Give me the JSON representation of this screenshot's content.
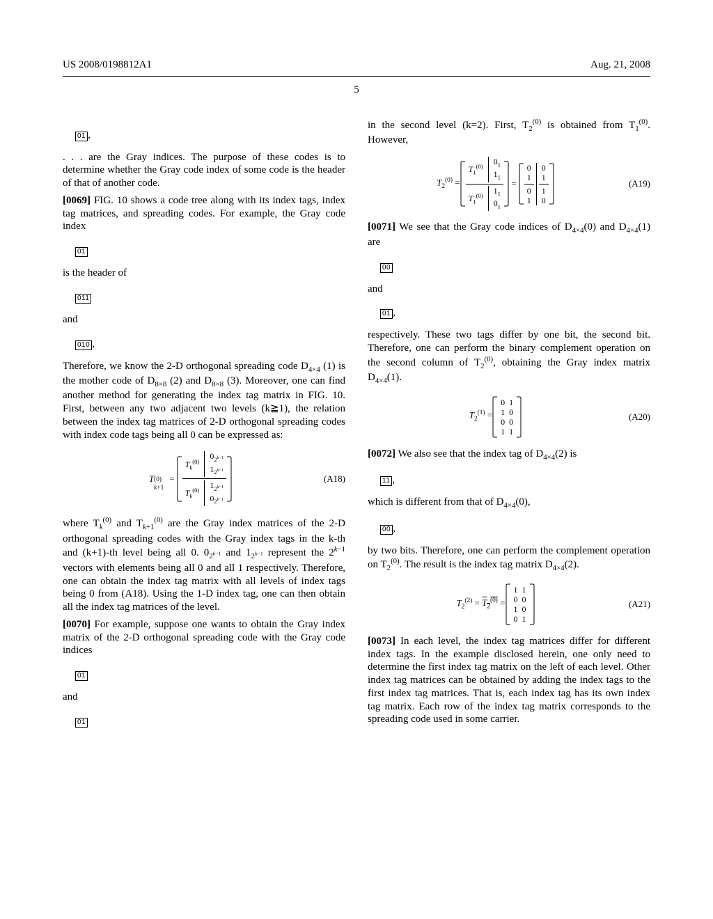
{
  "header": {
    "pub_no": "US 2008/0198812A1",
    "date": "Aug. 21, 2008",
    "page_no": "5"
  },
  "left": {
    "box1": "01",
    "p1": ". . . are the Gray indices. The purpose of these codes is to determine whether the Gray code index of some code is the header of that of another code.",
    "p2_ref": "[0069]",
    "p2": " FIG. 10 shows a code tree along with its index tags, index tag matrices, and spreading codes. For example, the Gray code index",
    "box2": "01",
    "p3": "is the header of",
    "box3": "011",
    "p4": "and",
    "box4": "010",
    "p5a": "Therefore, we know the 2-D orthogonal spreading code D",
    "p5b": " (1) is the mother code of D",
    "p5c": " (2) and D",
    "p5d": " (3). Moreover, one can find another method for generating the index tag matrix in FIG. 10. First, between any two adjacent two levels (k≧1), the relation between the index tag matrices of 2-D orthogonal spreading codes with index code tags being all 0 can be expressed as:",
    "eq_a18_label": "(A18)",
    "p6a": "where T",
    "p6b": " and T",
    "p6c": " are the Gray index matrices of the 2-D orthogonal spreading codes with the Gray index tags in the k-th and (k+1)-th level being all 0. 0",
    "p6d": " and 1",
    "p6e": " represent the 2",
    "p6f": " vectors with elements being all 0 and all 1 respectively. Therefore, one can obtain the index tag matrix with all levels of index tags being 0 from (A18). Using the 1-D index tag, one can then obtain all the index tag matrices of the level.",
    "p7_ref": "[0070]",
    "p7": " For example, suppose one wants to obtain the Gray index matrix of the 2-D orthogonal spreading code with the Gray code indices",
    "box5": "01",
    "p8": "and",
    "box6": "01"
  },
  "right": {
    "p1a": "in the second level (k=2). First, T",
    "p1b": " is obtained from T",
    "p1c": ". However,",
    "eq_a19_label": "(A19)",
    "p2_ref": "[0071]",
    "p2a": " We see that the Gray code indices of D",
    "p2b": "(0) and D",
    "p2c": "(1) are",
    "box1": "00",
    "p3": "and",
    "box2": "01",
    "p4a": "respectively. These two tags differ by one bit, the second bit. Therefore, one can perform the binary complement operation on the second column of T",
    "p4b": ", obtaining the Gray index matrix D",
    "p4c": "(1).",
    "eq_a20_label": "(A20)",
    "p5_ref": "[0072]",
    "p5a": " We also see that the index tag of D",
    "p5b": "(2) is",
    "box3": "11",
    "p6a": "which is different from that of D",
    "p6b": "(0),",
    "box4": "00",
    "p7a": "by two bits. Therefore, one can perform the complement operation on T",
    "p7b": ". The result is the index tag matrix D",
    "p7c": "(2).",
    "eq_a21_label": "(A21)",
    "p8_ref": "[0073]",
    "p8": " In each level, the index tag matrices differ for different index tags. In the example disclosed herein, one only need to determine the first index tag matrix on the left of each level. Other index tag matrices can be obtained by adding the index tags to the first index tag matrices. That is, each index tag has its own index tag matrix. Each row of the index tag matrix corresponds to the spreading code used in some carrier."
  },
  "chart_data": {
    "type": "table",
    "equations": [
      {
        "id": "A18",
        "lhs": "T_{k+1}^{(0)}",
        "rhs_structure": "block 2x2 partitioned matrix",
        "blocks": [
          [
            "T_k^{(0)}",
            "0_{2^{k-1}}"
          ],
          [
            "",
            "1_{2^{k-1}}"
          ],
          [
            "T_k^{(0)}",
            "1_{2^{k-1}}"
          ],
          [
            "",
            "0_{2^{k-1}}"
          ]
        ]
      },
      {
        "id": "A19",
        "lhs": "T_2^{(0)}",
        "middle_structure": "block partitioned from T_1^{(0)}",
        "middle_blocks": [
          [
            "T_1^{(0)}",
            "0_1"
          ],
          [
            "",
            "1_1"
          ],
          [
            "T_1^{(0)}",
            "1_1"
          ],
          [
            "",
            "0_1"
          ]
        ],
        "rhs_matrix": [
          [
            0,
            0
          ],
          [
            1,
            1
          ],
          [
            0,
            1
          ],
          [
            1,
            0
          ]
        ],
        "rhs_partition_col_after": 1
      },
      {
        "id": "A20",
        "lhs": "T_2^{(1)}",
        "rhs_matrix": [
          [
            0,
            1
          ],
          [
            1,
            0
          ],
          [
            0,
            0
          ],
          [
            1,
            1
          ]
        ]
      },
      {
        "id": "A21",
        "lhs": "T_2^{(2)} = \\overline{T_2^{(0)}}",
        "rhs_matrix": [
          [
            1,
            1
          ],
          [
            0,
            0
          ],
          [
            1,
            0
          ],
          [
            0,
            1
          ]
        ]
      }
    ]
  }
}
